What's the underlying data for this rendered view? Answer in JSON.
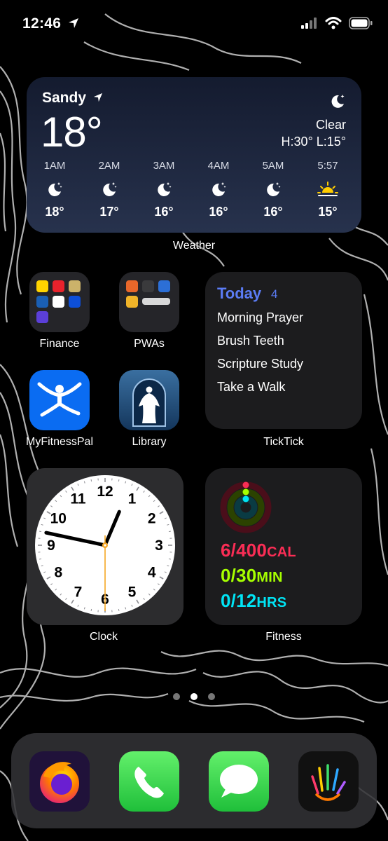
{
  "status": {
    "time": "12:46"
  },
  "weather": {
    "location": "Sandy",
    "temperature": "18°",
    "condition": "Clear",
    "high_low": "H:30° L:15°",
    "hourly": [
      {
        "time": "1AM",
        "icon": "moon-stars-icon",
        "temp": "18°"
      },
      {
        "time": "2AM",
        "icon": "moon-stars-icon",
        "temp": "17°"
      },
      {
        "time": "3AM",
        "icon": "moon-stars-icon",
        "temp": "16°"
      },
      {
        "time": "4AM",
        "icon": "moon-stars-icon",
        "temp": "16°"
      },
      {
        "time": "5AM",
        "icon": "moon-stars-icon",
        "temp": "16°"
      },
      {
        "time": "5:57",
        "icon": "sunrise-icon",
        "temp": "15°"
      }
    ],
    "caption": "Weather"
  },
  "apps": {
    "finance": "Finance",
    "pwas": "PWAs",
    "myfitnesspal": "MyFitnessPal",
    "library": "Library",
    "ticktick": "TickTick",
    "clock": "Clock",
    "fitness": "Fitness"
  },
  "ticktick": {
    "header": "Today",
    "count": "4",
    "tasks": [
      "Morning Prayer",
      "Brush Teeth",
      "Scripture Study",
      "Take a Walk"
    ]
  },
  "clock": {
    "numerals": [
      "12",
      "1",
      "2",
      "3",
      "4",
      "5",
      "6",
      "7",
      "8",
      "9",
      "10",
      "11"
    ],
    "hour_angle_deg": 23,
    "minute_angle_deg": 282,
    "second_angle_deg": 180
  },
  "fitness": {
    "move": "6/400",
    "move_unit": "CAL",
    "exercise": "0/30",
    "exercise_unit": "MIN",
    "stand": "0/12",
    "stand_unit": "HRS",
    "colors": {
      "move": "#fa2d55",
      "exercise": "#a6ff00",
      "stand": "#00e4f5"
    }
  },
  "dock": [
    "firefox-icon",
    "phone-icon",
    "messages-icon",
    "hand-paint-icon"
  ]
}
